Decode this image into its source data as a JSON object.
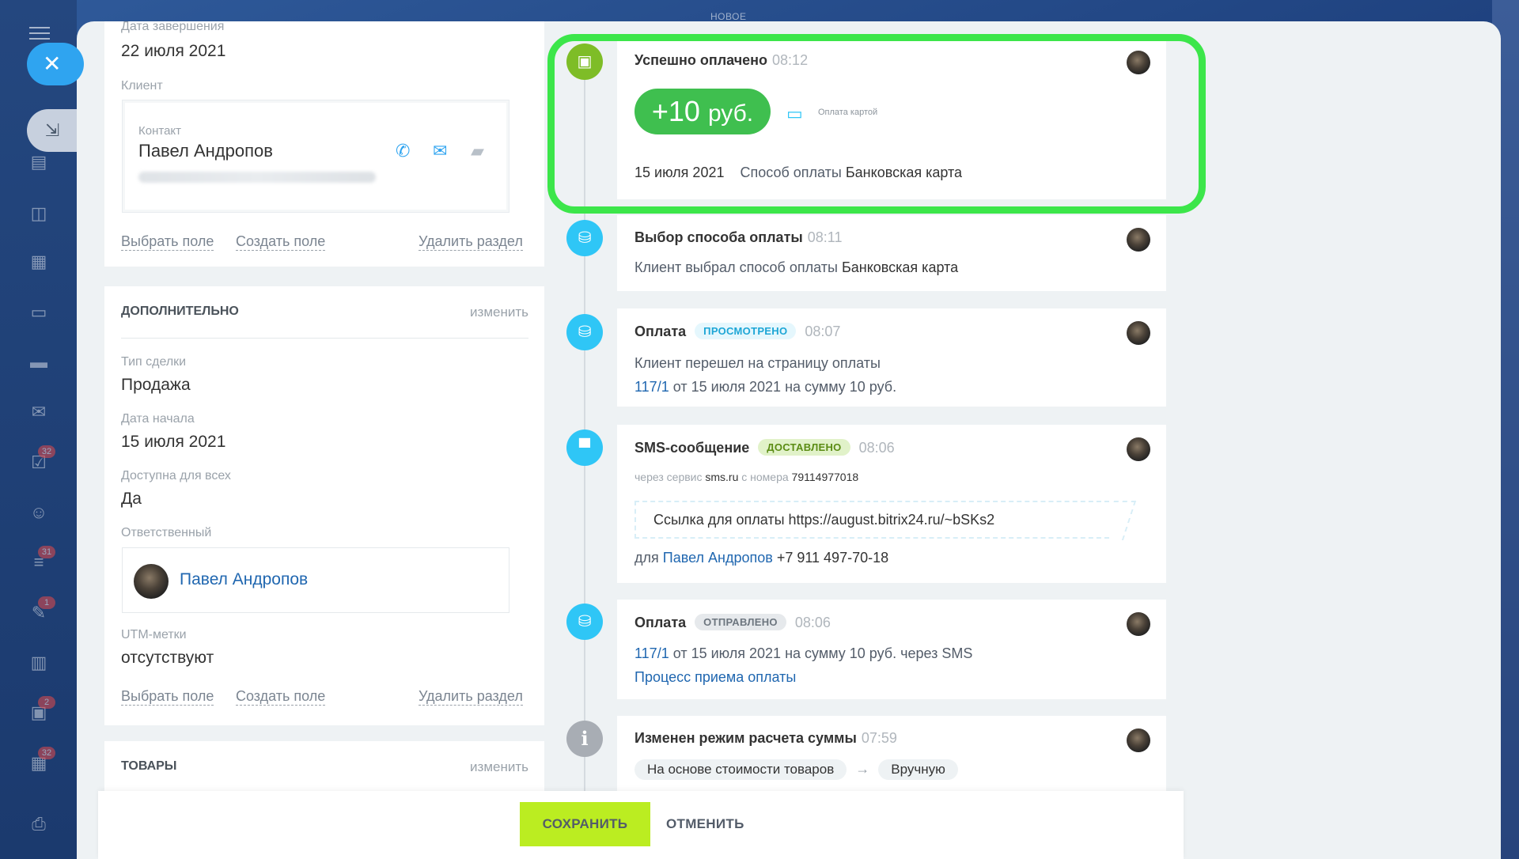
{
  "top_label": "НОВОЕ",
  "sidebar": {
    "badges": [
      "32",
      "31",
      "1",
      "2",
      "32"
    ]
  },
  "deal": {
    "end_date_label": "Дата завершения",
    "end_date": "22 июля 2021",
    "client_label": "Клиент",
    "contact_label": "Контакт",
    "contact_name": "Павел Андропов",
    "select_field": "Выбрать поле",
    "create_field": "Создать поле",
    "delete_section": "Удалить раздел"
  },
  "additional": {
    "title": "ДОПОЛНИТЕЛЬНО",
    "edit": "изменить",
    "deal_type_label": "Тип сделки",
    "deal_type": "Продажа",
    "start_date_label": "Дата начала",
    "start_date": "15 июля 2021",
    "available_label": "Доступна для всех",
    "available": "Да",
    "responsible_label": "Ответственный",
    "responsible": "Павел Андропов",
    "utm_label": "UTM-метки",
    "utm": "отсутствуют",
    "select_field": "Выбрать поле",
    "create_field": "Создать поле",
    "delete_section": "Удалить раздел"
  },
  "products": {
    "title": "ТОВАРЫ",
    "edit": "изменить"
  },
  "timeline": {
    "paid": {
      "title": "Успешно оплачено",
      "time": "08:12",
      "amount_sign": "+",
      "amount": "10",
      "currency": "руб.",
      "card_label": "Оплата картой",
      "date": "15 июля 2021",
      "method_label": "Способ оплаты",
      "method": "Банковская карта"
    },
    "choice": {
      "title": "Выбор способа оплаты",
      "time": "08:11",
      "text": "Клиент выбрал способ оплаты",
      "method": "Банковская карта"
    },
    "payment_viewed": {
      "title": "Оплата",
      "badge": "ПРОСМОТРЕНО",
      "time": "08:07",
      "text": "Клиент перешел на страницу оплаты",
      "order_link": "117/1",
      "order_text": "от 15 июля 2021 на сумму 10 руб."
    },
    "sms": {
      "title": "SMS-сообщение",
      "badge": "ДОСТАВЛЕНО",
      "time": "08:06",
      "via_prefix": "через сервис",
      "service": "sms.ru",
      "from_prefix": "с номера",
      "from_number": "79114977018",
      "message": "Ссылка для оплаты https://august.bitrix24.ru/~bSKs2",
      "to_prefix": "для",
      "to_name": "Павел Андропов",
      "to_phone": "+7 911 497-70-18"
    },
    "payment_sent": {
      "title": "Оплата",
      "badge": "ОТПРАВЛЕНО",
      "time": "08:06",
      "order_link": "117/1",
      "order_text": "от 15 июля 2021 на сумму 10 руб. через SMS",
      "process_link": "Процесс приема оплаты"
    },
    "mode_change": {
      "title": "Изменен режим расчета суммы",
      "time": "07:59",
      "from": "На основе стоимости товаров",
      "arrow": "→",
      "to": "Вручную"
    }
  },
  "footer": {
    "save": "СОХРАНИТЬ",
    "cancel": "ОТМЕНИТЬ"
  },
  "colors": {
    "highlight": "#3ce64a",
    "accent": "#2fc6f6",
    "save": "#bbed21",
    "link": "#2067b0"
  }
}
